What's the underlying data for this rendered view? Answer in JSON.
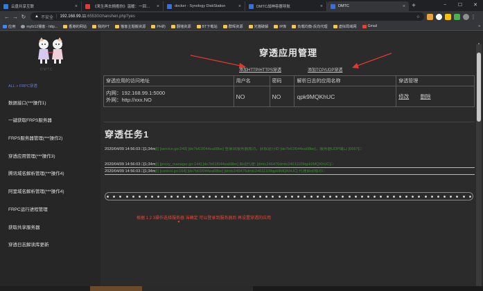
{
  "browser": {
    "tabs": [
      {
        "label": "云盘共享互联",
        "color": "#2a7de1",
        "active": false
      },
      {
        "label": "《来生再去拥抱你》温暖：一回…",
        "color": "#e53935",
        "active": false
      },
      {
        "label": "docker - Synology DiskStation",
        "color": "#3a6fd8",
        "active": false
      },
      {
        "label": "DMTC战神容器导航",
        "color": "#3a6fd8",
        "active": false
      },
      {
        "label": "DMTC",
        "color": "#3a6fd8",
        "active": true
      }
    ],
    "new_tab": "+",
    "window_controls": {
      "minimize": "−",
      "maximize": "☐",
      "close": "✕"
    },
    "address": {
      "warning_icon": "▲",
      "security_label": "不安全",
      "separator": "|",
      "host": "192.168.99.11",
      "path": ":65530/zhanshen.php?yes"
    },
    "bookmarks": [
      {
        "label": "应用",
        "icon": "app"
      },
      {
        "label": "myfz12播客 - http...",
        "icon": "site"
      },
      {
        "label": "香港的网站",
        "icon": "folder"
      },
      {
        "label": "我的PT",
        "icon": "folder"
      },
      {
        "label": "猫客主题搬资源",
        "icon": "folder"
      },
      {
        "label": "PH的",
        "icon": "folder"
      },
      {
        "label": "翻墙资源",
        "icon": "folder"
      },
      {
        "label": "BT下载站",
        "icon": "folder"
      },
      {
        "label": "群晖资源",
        "icon": "folder"
      },
      {
        "label": "光猫破解",
        "icon": "folder"
      },
      {
        "label": "IP库",
        "icon": "folder"
      },
      {
        "label": "负载均衡-反向代理",
        "icon": "folder"
      },
      {
        "label": "虚拟局域网",
        "icon": "folder"
      },
      {
        "label": "Gmail",
        "icon": "gmail"
      }
    ],
    "bookmarks_more": "»"
  },
  "sidebar": {
    "logo_text": "DMTC",
    "breadcrumb": "ALL > FRPC穿透",
    "items": [
      "数据接口(***操作1)",
      "一键获取FRPS服务器",
      "FRPS服务器管理(***操作2)",
      "穿透应用管理(***操作3)",
      "腾讯域名解析管理(***操作4)",
      "阿里域名解析管理(***操作4)",
      "FRPC运行进程管理",
      "获取共享服务器",
      "穿透日志解读库更新"
    ]
  },
  "main": {
    "title": "穿透应用管理",
    "link_http": "添加HTTP/HTTPS穿透",
    "link_tcp": "添加TCP/UDP穿透",
    "table": {
      "headers": [
        "穿透应用的访问地址",
        "用户名",
        "密码",
        "解析日志的应用名称",
        "穿透管理"
      ],
      "row": {
        "intranet": "内网：192.168.99.1:5000",
        "extranet": "外网：http://xxx.NO",
        "username": "NO",
        "password": "NO",
        "app_name": "qpk9MQKhUC",
        "edit": "修改",
        "delete": "删除"
      }
    },
    "task_heading": "穿透任务1",
    "logs": [
      {
        "ts": "2020/04/09 14:56:03 □[1;34m",
        "msg": "[I] [service.go:249] [de7b61f044ea68be] 登录到服务器成功，获取运行ID [de7b61f044ea68be]，服务器UDP端口 [6667]□"
      },
      {
        "ts": "2020/04/09 14:56:03 □[1;34m",
        "msg": "[I] [proxy_manager.go:144] [de7b61f044ea68be] 启动代理: [dmtc246476dmtc24611109qpk9MQKhUC]□"
      },
      {
        "ts": "2020/04/09 14:56:03 □[1;34m",
        "msg": "[I] [control.go:164] [de7b61f044ea68be] [dmtc246476dmtc24611109qpk9MQKhUC] 代理启动成功□"
      }
    ],
    "hint": "根据 1 2 3操作选择服务器    当确定 可以登录到服务器后 再设置穿透的应用",
    "hint_marker": "◄"
  },
  "colors": {
    "log_green": "#3a8a2e",
    "hint_red": "#e04a3a",
    "arrow_red": "#e03a2e",
    "breadcrumb_blue": "#6a7bd6"
  }
}
